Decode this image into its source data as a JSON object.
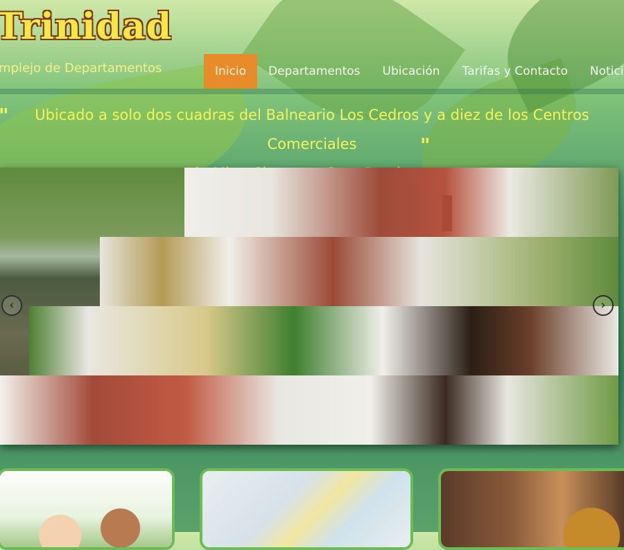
{
  "brand": {
    "title": "Trinidad",
    "tagline": "mplejo de Departamentos"
  },
  "nav": {
    "items": [
      {
        "label": "Inicio",
        "active": true
      },
      {
        "label": "Departamentos",
        "active": false
      },
      {
        "label": "Ubicación",
        "active": false
      },
      {
        "label": "Tarifas y Contacto",
        "active": false
      },
      {
        "label": "Noticias",
        "active": false
      }
    ]
  },
  "intro": {
    "quote_line1": "Ubicado a solo dos cuadras del Balneario Los Cedros y a diez de los Centros Comerciales",
    "quote_line2": "de Mina Clavero y Cura Brochero.",
    "open_mark": "\"",
    "close_mark": "\""
  },
  "slider": {
    "prev_icon": "chevron-left-icon",
    "next_icon": "chevron-right-icon"
  },
  "cards": [
    {
      "name": "family-photo"
    },
    {
      "name": "location-map"
    },
    {
      "name": "reception-bell-photo"
    }
  ],
  "colors": {
    "accent": "#e88b2a",
    "text_highlight": "#f6f35a",
    "frame_green": "#6dbb55"
  }
}
